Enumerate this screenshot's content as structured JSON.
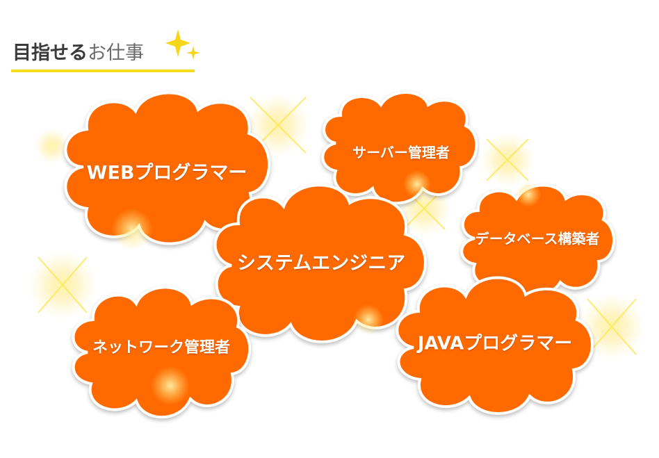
{
  "heading": {
    "text_dark": "目指せる",
    "text_light": "お仕事"
  },
  "colors": {
    "cloud_fill": "#ff6a00",
    "cloud_outline": "#ffffff",
    "underline": "#f3dc1e",
    "sparkle": "#ffe34a"
  },
  "jobs": [
    {
      "id": "web",
      "label": "WEBプログラマー"
    },
    {
      "id": "server",
      "label": "サーバー管理者"
    },
    {
      "id": "db",
      "label": "データベース構築者"
    },
    {
      "id": "se",
      "label": "システムエンジニア"
    },
    {
      "id": "network",
      "label": "ネットワーク管理者"
    },
    {
      "id": "java",
      "label": "JAVAプログラマー"
    }
  ]
}
